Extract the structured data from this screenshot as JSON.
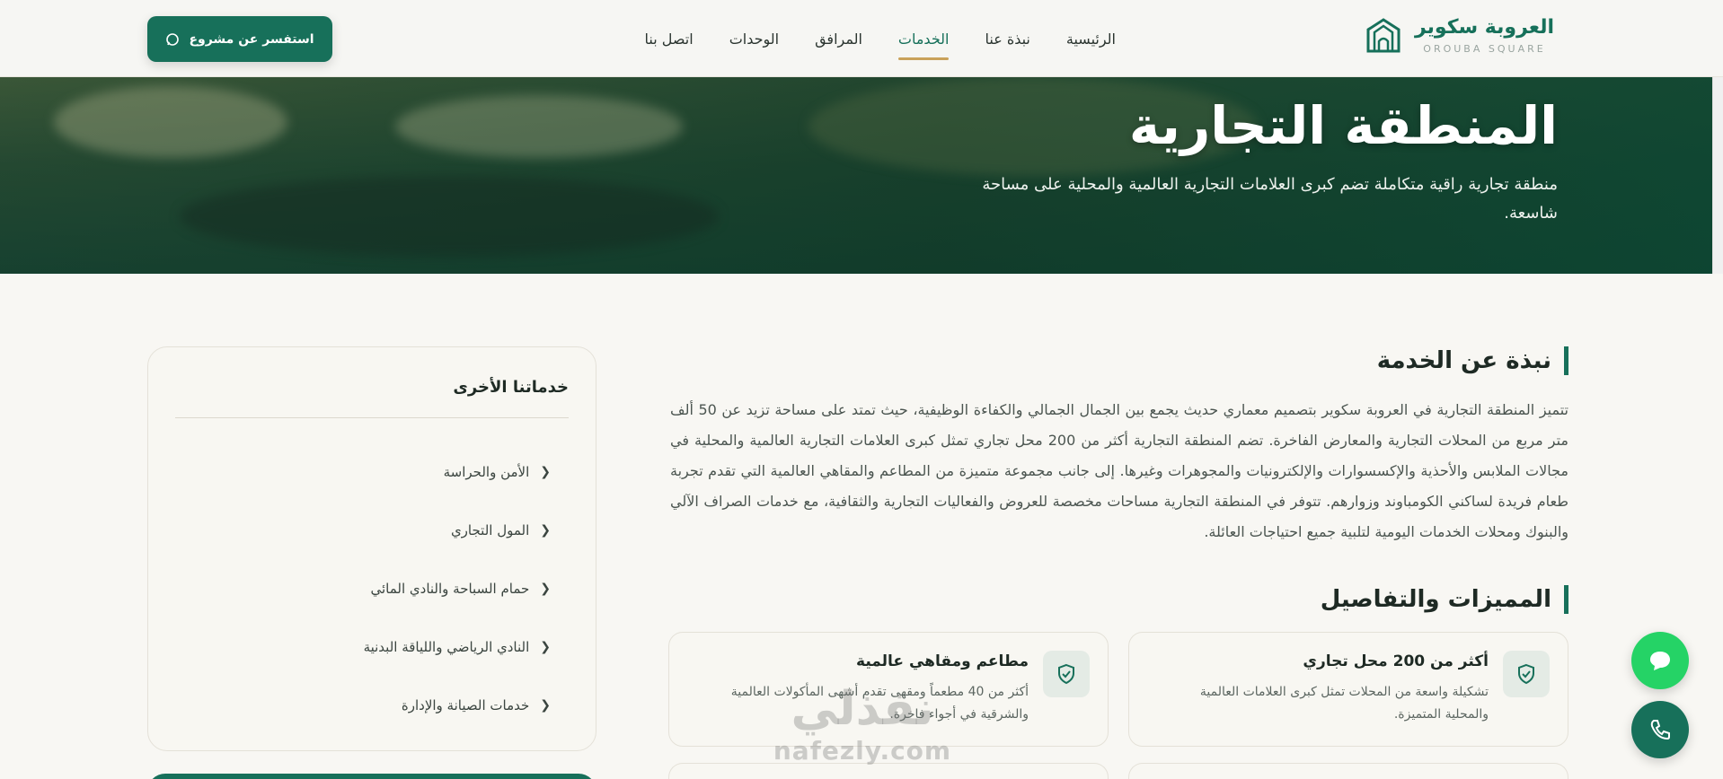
{
  "header": {
    "logo_ar": "العروبة سكوير",
    "logo_en": "OROUBA SQUARE",
    "nav": [
      {
        "label": "الرئيسية"
      },
      {
        "label": "نبذة عنا"
      },
      {
        "label": "الخدمات"
      },
      {
        "label": "المرافق"
      },
      {
        "label": "الوحدات"
      },
      {
        "label": "اتصل بنا"
      }
    ],
    "active_nav": "الخدمات",
    "cta_label": "استفسر عن مشروع",
    "cta_icon": "whatsapp-icon"
  },
  "hero": {
    "title": "المنطقة التجارية",
    "subtitle": "منطقة تجارية راقية متكاملة تضم كبرى العلامات التجارية العالمية والمحلية على مساحة شاسعة."
  },
  "about": {
    "title": "نبذة عن الخدمة",
    "text": "تتميز المنطقة التجارية في العروبة سكوير بتصميم معماري حديث يجمع بين الجمال الجمالي والكفاءة الوظيفية، حيث تمتد على مساحة تزيد عن 50 ألف متر مربع من المحلات التجارية والمعارض الفاخرة. تضم المنطقة التجارية أكثر من 200 محل تجاري تمثل كبرى العلامات التجارية العالمية والمحلية في مجالات الملابس والأحذية والإكسسوارات والإلكترونيات والمجوهرات وغيرها. إلى جانب مجموعة متميزة من المطاعم والمقاهي العالمية التي تقدم تجربة طعام فريدة لساكني الكومباوند وزوارهم. تتوفر في المنطقة التجارية مساحات مخصصة للعروض والفعاليات التجارية والثقافية، مع خدمات الصراف الآلي والبنوك ومحلات الخدمات اليومية لتلبية جميع احتياجات العائلة."
  },
  "features": {
    "title": "المميزات والتفاصيل",
    "items": [
      {
        "title": "أكثر من 200 محل تجاري",
        "desc": "تشكيلة واسعة من المحلات تمثل كبرى العلامات العالمية والمحلية المتميزة.",
        "icon": "shield-check-icon"
      },
      {
        "title": "مطاعم ومقاهي عالمية",
        "desc": "أكثر من 40 مطعماً ومقهى تقدم أشهى المأكولات العالمية والشرقية في أجواء فاخرة.",
        "icon": "shield-check-icon"
      }
    ]
  },
  "sidebar": {
    "title": "خدماتنا الأخرى",
    "items": [
      {
        "label": "الأمن والحراسة"
      },
      {
        "label": "المول التجاري"
      },
      {
        "label": "حمام السباحة والنادي المائي"
      },
      {
        "label": "النادي الرياضي واللياقة البدنية"
      },
      {
        "label": "خدمات الصيانة والإدارة"
      }
    ]
  },
  "floating": {
    "chat_icon": "chat-bubble-icon",
    "phone_icon": "phone-icon",
    "chat_color": "#25d366",
    "phone_color": "#17705a"
  },
  "watermark": {
    "ar": "نفذلي",
    "en": "nafezly.com"
  },
  "colors": {
    "brand": "#17705a",
    "accent": "#c9a25a",
    "background": "#f8f7f3"
  }
}
